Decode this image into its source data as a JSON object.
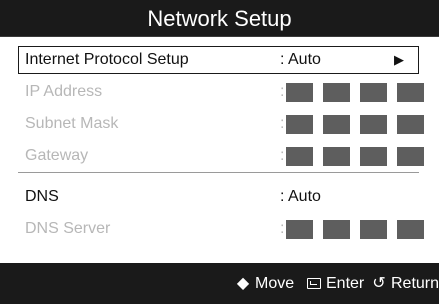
{
  "dialog": {
    "title": "Network Setup"
  },
  "rows": [
    {
      "label": "Internet Protocol Setup",
      "value": ": Auto",
      "arrow": "▶",
      "state": "selected"
    },
    {
      "label": "IP Address",
      "value": ":",
      "state": "disabled"
    },
    {
      "label": "Subnet Mask",
      "value": ":",
      "state": "disabled"
    },
    {
      "label": "Gateway",
      "value": ":",
      "state": "disabled"
    },
    {
      "label": "DNS",
      "value": ": Auto",
      "state": "enabled"
    },
    {
      "label": "DNS Server",
      "value": ":",
      "state": "disabled"
    }
  ],
  "footer": {
    "move_icon": "updown-arrow-icon",
    "move_label": "Move",
    "enter_icon": "enter-icon",
    "enter_label": "Enter",
    "return_icon": "return-icon",
    "return_label": "Return"
  },
  "colors": {
    "title_bar": "#1a1a1a",
    "background": "#ffffff",
    "disabled_text": "#b7b7b7",
    "octet_box": "#5e5e5e"
  }
}
